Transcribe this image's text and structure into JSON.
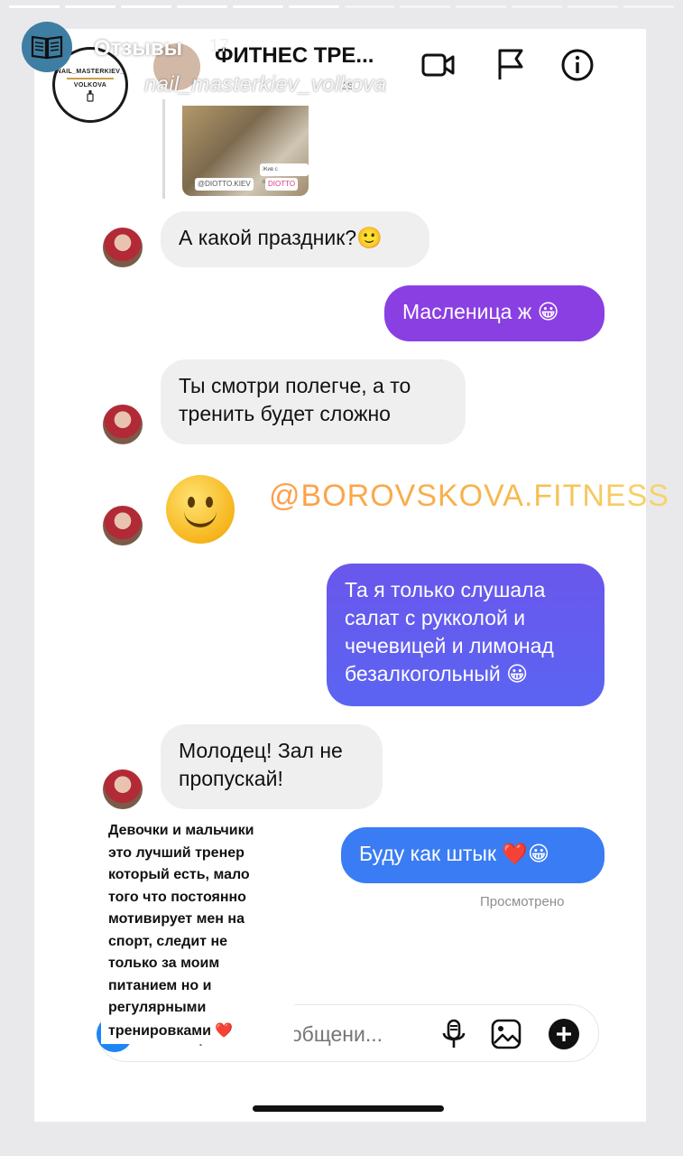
{
  "story": {
    "title": "Отзывы",
    "time": "17",
    "username": "nail_masterkiev_volkova",
    "brand_lines": [
      "NAIL_MASTERKIEV_",
      "VOLKOVA"
    ],
    "progress_segments": 12,
    "progress_done": 6
  },
  "chat": {
    "title": "ФИТНЕС ТРЕ...",
    "title_fragment": "ss",
    "icons": [
      "video-camera-icon",
      "flag-icon",
      "info-icon"
    ],
    "post_tags": [
      "@DIOTTO.KIEV",
      "Жив с праздником",
      "DIOTTO"
    ]
  },
  "messages": [
    {
      "side": "in",
      "text": "А какой праздник?",
      "emoji": "🙂"
    },
    {
      "side": "out",
      "text": "Масленица ж",
      "emoji": "😀"
    },
    {
      "side": "in",
      "lines": [
        "Ты смотри полегче, а то",
        "тренить будет сложно"
      ]
    },
    {
      "side": "in",
      "big_emoji": "🙂"
    },
    {
      "side": "out",
      "lines": [
        "Та я только слушала",
        "салат с рукколой и",
        "чечевицей и лимонад"
      ],
      "last_line": "безалкогольный",
      "emoji": "😀"
    },
    {
      "side": "in",
      "lines": [
        "Молодец! Зал не",
        "пропускай!"
      ]
    },
    {
      "side": "out",
      "text": "Буду как штык",
      "emoji": "❤️😀"
    }
  ],
  "watermark": "@BOROVSKOVA.FITNESS",
  "seen_label": "Просмотрено",
  "overlay": {
    "lines": [
      "Девочки и мальчики",
      "это лучший тренер",
      "который есть, мало",
      "того что постоянно",
      "мотивирует мен на",
      "спорт, следит не",
      "только за моим",
      "питанием но и",
      "регулярными"
    ],
    "last_line": "тренировками",
    "heart": "❤️"
  },
  "composer": {
    "placeholder": "Отправьте сообщени...",
    "icons": [
      "camera-icon",
      "microphone-icon",
      "gallery-icon",
      "plus-icon"
    ]
  },
  "colors": {
    "out_purple": "#8a3fe3",
    "out_indigo": "#5e5ef0",
    "out_blue": "#3a7cf3",
    "in_bubble": "#efefef",
    "accent_blue": "#1d86f5"
  }
}
